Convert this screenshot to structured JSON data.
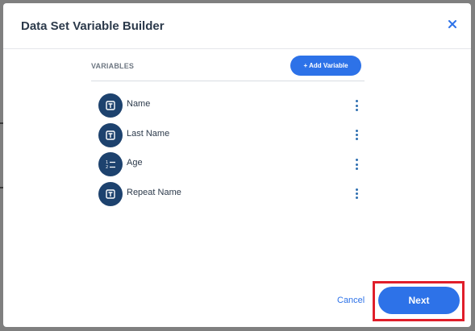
{
  "dialog": {
    "title": "Data Set Variable Builder",
    "close_icon": "close-icon"
  },
  "variables_section": {
    "label": "VARIABLES",
    "add_button_label": "+ Add Variable"
  },
  "variables": [
    {
      "name": "Name",
      "icon": "text-field-icon"
    },
    {
      "name": "Last Name",
      "icon": "text-field-icon"
    },
    {
      "name": "Age",
      "icon": "numbered-list-icon"
    },
    {
      "name": "Repeat Name",
      "icon": "text-field-icon"
    }
  ],
  "footer": {
    "cancel_label": "Cancel",
    "next_label": "Next"
  },
  "colors": {
    "primary": "#2d72e8",
    "icon_bg": "#1d426e",
    "highlight": "#e01e2a",
    "title": "#2c3a4b"
  }
}
